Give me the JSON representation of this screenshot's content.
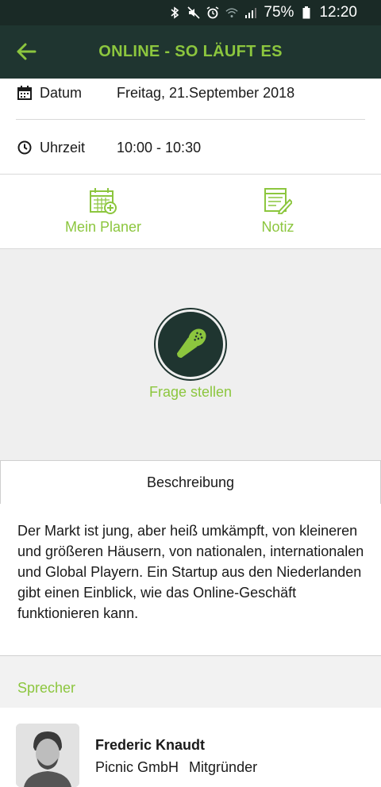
{
  "status_bar": {
    "battery": "75%",
    "time": "12:20",
    "icons": [
      "bluetooth-icon",
      "mute-icon",
      "alarm-icon",
      "wifi-icon",
      "signal-icon",
      "battery-icon"
    ]
  },
  "app_bar": {
    "title": "ONLINE - SO LÄUFT ES",
    "back_icon": "arrow-left-icon"
  },
  "info": {
    "date_label": "Datum",
    "date_value": "Freitag, 21.September 2018",
    "time_label": "Uhrzeit",
    "time_value": "10:00 - 10:30"
  },
  "actions": {
    "planner_label": "Mein Planer",
    "note_label": "Notiz"
  },
  "question": {
    "label": "Frage stellen"
  },
  "tabs": {
    "description": "Beschreibung"
  },
  "description": "Der Markt ist jung, aber heiß umkämpft, von kleineren und größeren Häusern, von nationalen, internationalen und Global Playern. Ein Startup aus den Niederlanden gibt einen Einblick, wie das Online-Geschäft funktionieren kann.",
  "speakers": {
    "header": "Sprecher",
    "items": [
      {
        "name": "Frederic Knaudt",
        "company": "Picnic GmbH",
        "role": "Mitgründer"
      }
    ]
  },
  "colors": {
    "accent": "#8cc63e",
    "app_bar": "#1f3530",
    "status_bar": "#1a2a26"
  }
}
